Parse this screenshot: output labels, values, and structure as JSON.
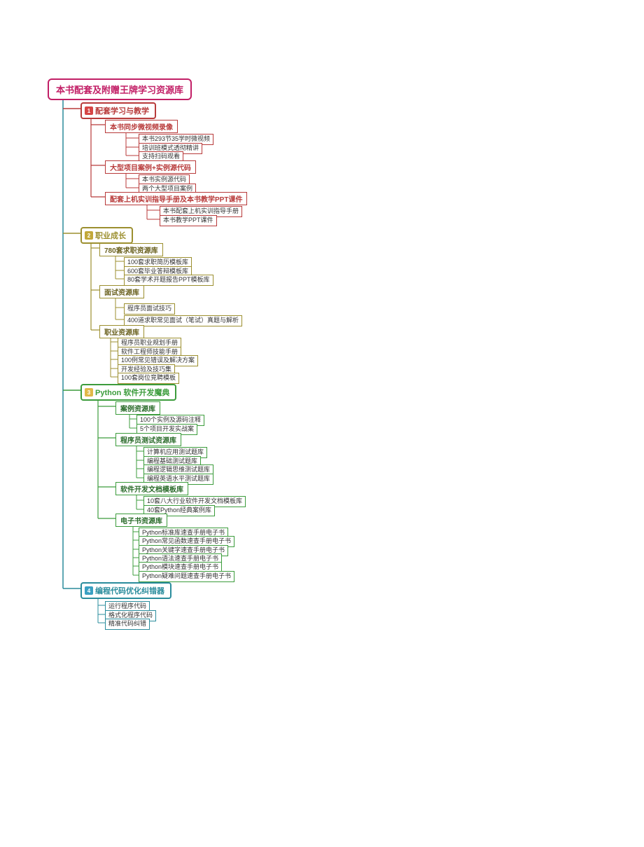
{
  "colors": {
    "root": "#c21f66",
    "sec1": "#b83a3a",
    "sec1border": "#b83a3a",
    "sec2": "#9c8f2f",
    "sec2border": "#9c8f2f",
    "sec3": "#3c9c3c",
    "sec3border": "#3c9c3c",
    "sec4": "#2a8c9c",
    "sec4border": "#2a8c9c",
    "trunk": "#2a8c9c"
  },
  "root": "本书配套及附赠王牌学习资源库",
  "sections": [
    {
      "num": "1",
      "title": "配套学习与教学",
      "color": "#b83a3a",
      "badge": "#d64545",
      "mids": [
        {
          "label": "本书同步微视频录像",
          "leaves": [
            "本书293节35学时微视频",
            "培训班模式透彻精讲",
            "支持扫码观看"
          ]
        },
        {
          "label": "大型项目案例+实例源代码",
          "leaves": [
            "本书实例源代码",
            "两个大型项目案例"
          ]
        },
        {
          "label": "配套上机实训指导手册及本书教学PPT课件",
          "leaves": [
            "本书配套上机实训指导手册",
            "本书教学PPT课件"
          ]
        }
      ]
    },
    {
      "num": "2",
      "title": "职业成长",
      "color": "#9c8f2f",
      "badge": "#c2a83a",
      "mids": [
        {
          "label": "780套求职资源库",
          "leaves": [
            "100套求职简历模板库",
            "600套毕业答辩模板库",
            "80套学术开题报告PPT模板库"
          ]
        },
        {
          "label": "面试资源库",
          "leaves": [
            "程序员面试技巧",
            "400道求职常见面试（笔试）真题与解析"
          ]
        },
        {
          "label": "职业资源库",
          "leaves": [
            "程序员职业规划手册",
            "软件工程师技能手册",
            "100例常见错误及解决方案",
            "开发经验及技巧集",
            "100套岗位竞聘模板"
          ]
        }
      ]
    },
    {
      "num": "3",
      "title": "Python  软件开发魔典",
      "color": "#3c9c3c",
      "badge": "#e0b848",
      "mids": [
        {
          "label": "案例资源库",
          "leaves": [
            "100个实例及源码注释",
            "5个项目开发实战案"
          ]
        },
        {
          "label": "程序员测试资源库",
          "leaves": [
            "计算机应用测试题库",
            "编程基础测试题库",
            "编程逻辑思维测试题库",
            "编程英语水平测试题库"
          ]
        },
        {
          "label": "软件开发文档模板库",
          "leaves": [
            "10套八大行业软件开发文档模板库",
            "40套Python经典案例库"
          ]
        },
        {
          "label": "电子书资源库",
          "leaves": [
            "Python标准库速查手册电子书",
            "Python常见函数速查手册电子书",
            "Python关键字速查手册电子书",
            "Python语法速查手册电子书",
            "Python模块速查手册电子书",
            "Python疑难问题速查手册电子书"
          ]
        }
      ]
    },
    {
      "num": "4",
      "title": "编程代码优化纠错器",
      "color": "#2a8c9c",
      "badge": "#3aa0c2",
      "mids": [
        {
          "label": "",
          "leaves": [
            "运行程序代码",
            "格式化程序代码",
            "精准代码纠错"
          ]
        }
      ]
    }
  ]
}
